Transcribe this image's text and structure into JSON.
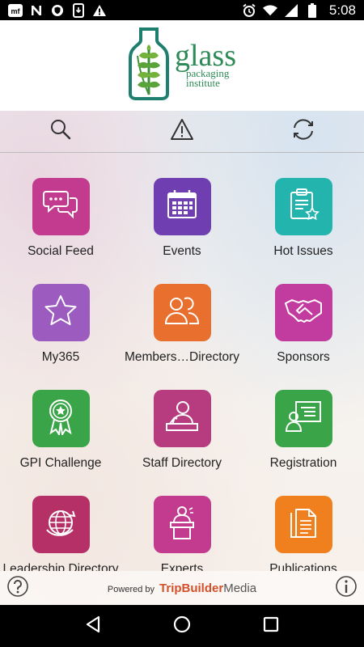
{
  "status_bar": {
    "time": "5:08",
    "left_icons": [
      "myfitnesspal-icon",
      "n-icon",
      "vpn-shield-icon",
      "phone-download-icon",
      "warning-icon"
    ],
    "right_icons": [
      "alarm-icon",
      "wifi-icon",
      "signal-icon",
      "battery-icon"
    ]
  },
  "logo": {
    "big": "glass",
    "line1": "packaging",
    "line2": "institute"
  },
  "toolbar": {
    "items": [
      "search-icon",
      "alert-icon",
      "sync-icon"
    ]
  },
  "tiles": [
    {
      "label": "Social Feed",
      "color": "#c23b8e",
      "icon": "chat-bubbles-icon"
    },
    {
      "label": "Events",
      "color": "#6f3fb2",
      "icon": "calendar-icon"
    },
    {
      "label": "Hot Issues",
      "color": "#23b4ad",
      "icon": "clipboard-star-icon"
    },
    {
      "label": "My365",
      "color": "#9b5bbf",
      "icon": "star-icon"
    },
    {
      "label": "Members…Directory",
      "color": "#e96f2e",
      "icon": "people-icon"
    },
    {
      "label": "Sponsors",
      "color": "#c23b9e",
      "icon": "handshake-icon"
    },
    {
      "label": "GPI Challenge",
      "color": "#3aa548",
      "icon": "ribbon-award-icon"
    },
    {
      "label": "Staff Directory",
      "color": "#b63b7f",
      "icon": "person-desk-icon"
    },
    {
      "label": "Registration",
      "color": "#3aa548",
      "icon": "registration-board-icon"
    },
    {
      "label": "Leadership Directory",
      "color": "#b63068",
      "icon": "globe-icon"
    },
    {
      "label": "Experts",
      "color": "#c23b8e",
      "icon": "podium-speaker-icon"
    },
    {
      "label": "Publications",
      "color": "#f07f1e",
      "icon": "document-icon"
    }
  ],
  "footer": {
    "powered_by": "Powered by",
    "brand_part1": "TripBuilder",
    "brand_part2": "Media",
    "help_icon": "help-icon",
    "info_icon": "info-icon"
  },
  "nav_bar": [
    "back-icon",
    "home-icon",
    "recents-icon"
  ]
}
